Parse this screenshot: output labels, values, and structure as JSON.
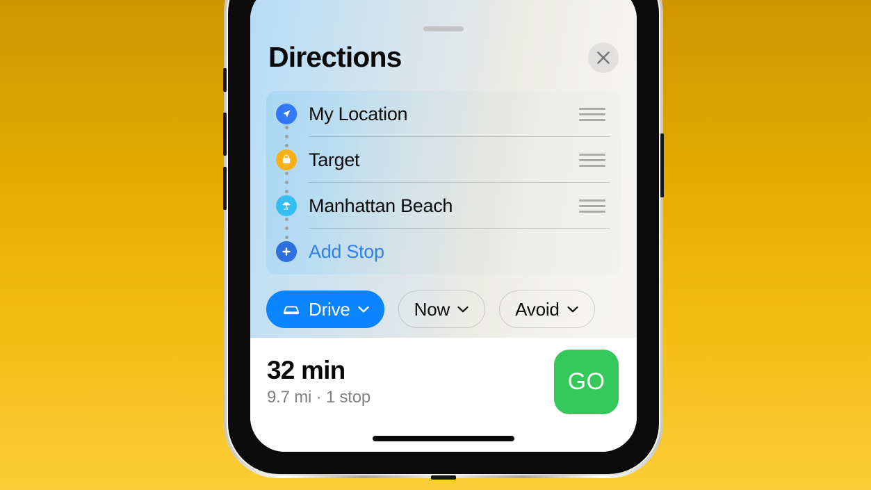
{
  "background": {
    "gradient_top": "#cf9500",
    "gradient_bottom": "#fbcd36"
  },
  "device": {
    "frame_color": "#0b0b0b",
    "rail_color": "#e6e3db"
  },
  "sheet": {
    "grabber": "drag-handle",
    "title": "Directions",
    "close_label": "Close",
    "close_icon": "close-icon"
  },
  "route": {
    "stops": [
      {
        "label": "My Location",
        "icon": "navigation-arrow-icon",
        "icon_color": "#3478f6",
        "is_link": false,
        "reorder_icon": "reorder-handle-icon"
      },
      {
        "label": "Target",
        "icon": "shopping-bag-icon",
        "icon_color": "#fbb014",
        "is_link": false,
        "reorder_icon": "reorder-handle-icon"
      },
      {
        "label": "Manhattan Beach",
        "icon": "beach-umbrella-icon",
        "icon_color": "#35bdf2",
        "is_link": false,
        "reorder_icon": "reorder-handle-icon"
      }
    ],
    "add_stop": {
      "label": "Add Stop",
      "icon": "plus-icon",
      "icon_color": "#2f6fe0",
      "text_color": "#2f7fec"
    }
  },
  "filters": [
    {
      "label": "Drive",
      "icon": "car-icon",
      "chevron": "chevron-down-icon",
      "active": true
    },
    {
      "label": "Now",
      "icon": null,
      "chevron": "chevron-down-icon",
      "active": false
    },
    {
      "label": "Avoid",
      "icon": null,
      "chevron": "chevron-down-icon",
      "active": false
    }
  ],
  "summary": {
    "duration": "32 min",
    "details": "9.7 mi · 1 stop",
    "go_label": "GO",
    "go_color": "#34c759"
  },
  "home_indicator": "home-indicator-bar"
}
